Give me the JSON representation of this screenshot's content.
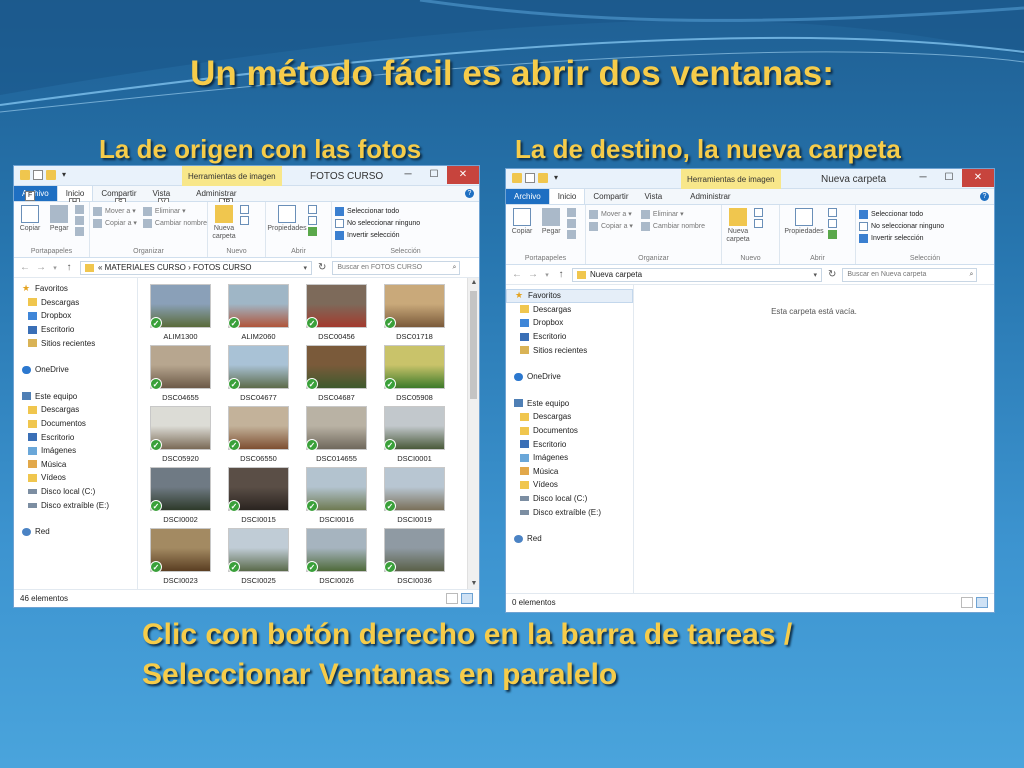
{
  "slide": {
    "title": "Un método fácil es abrir dos ventanas:",
    "subtitle_left": "La de origen con las fotos",
    "subtitle_right": "La de destino, la nueva carpeta",
    "bottom_line1": "Clic con botón derecho en la barra de tareas /",
    "bottom_line2": "Seleccionar Ventanas en paralelo"
  },
  "ribbon_common": {
    "tabs": [
      "Archivo",
      "Inicio",
      "Compartir",
      "Vista",
      "Administrar"
    ],
    "contextual_tab": "Herramientas de imagen",
    "copiar": "Copiar",
    "pegar": "Pegar",
    "mover_a": "Mover a ▾",
    "copiar_a": "Copiar a ▾",
    "eliminar": "Eliminar ▾",
    "cambiar_nombre": "Cambiar nombre",
    "nueva_carpeta_1": "Nueva",
    "nueva_carpeta_2": "carpeta",
    "propiedades": "Propiedades",
    "seleccionar_todo": "Seleccionar todo",
    "no_seleccionar": "No seleccionar ninguno",
    "invertir": "Invertir selección",
    "grp_portapapeles": "Portapapeles",
    "grp_organizar": "Organizar",
    "grp_nuevo": "Nuevo",
    "grp_abrir": "Abrir",
    "grp_seleccion": "Selección"
  },
  "window_left": {
    "title": "FOTOS CURSO",
    "keytips": [
      "H",
      "S",
      "V",
      "JP",
      "F",
      "1",
      "2",
      "E"
    ],
    "breadcrumb": "«  MATERIALES CURSO  ›  FOTOS CURSO",
    "search_placeholder": "Buscar en FOTOS CURSO",
    "status": "46 elementos",
    "photos": [
      {
        "name": "ALIM1300",
        "c1": "#8aa0b8",
        "c2": "#5a6b3a"
      },
      {
        "name": "ALIM2060",
        "c1": "#9fb6c6",
        "c2": "#b0553a"
      },
      {
        "name": "DSC00456",
        "c1": "#7d6a5a",
        "c2": "#a33a2e"
      },
      {
        "name": "DSC01718",
        "c1": "#c9a97a",
        "c2": "#7a5a3a"
      },
      {
        "name": "DSC04655",
        "c1": "#b7a68f",
        "c2": "#6c5a48"
      },
      {
        "name": "DSC04677",
        "c1": "#a9c2d6",
        "c2": "#5d6b4a"
      },
      {
        "name": "DSC04687",
        "c1": "#7a5a3a",
        "c2": "#3e5a2e"
      },
      {
        "name": "DSC05908",
        "c1": "#c9c36a",
        "c2": "#3d7a2a"
      },
      {
        "name": "DSC05920",
        "c1": "#dcdcd6",
        "c2": "#7a6a56"
      },
      {
        "name": "DSC06550",
        "c1": "#c3b29a",
        "c2": "#7d4f32"
      },
      {
        "name": "DSC014655",
        "c1": "#b9b2a4",
        "c2": "#6f685c"
      },
      {
        "name": "DSCI0001",
        "c1": "#c2c8cc",
        "c2": "#4a5a3a"
      },
      {
        "name": "DSCI0002",
        "c1": "#6f7a84",
        "c2": "#2e3a2a"
      },
      {
        "name": "DSCI0015",
        "c1": "#5a4e46",
        "c2": "#2a2420"
      },
      {
        "name": "DSCI0016",
        "c1": "#b3c3cf",
        "c2": "#6e7a52"
      },
      {
        "name": "DSCI0019",
        "c1": "#b8c6d2",
        "c2": "#7a705a"
      },
      {
        "name": "DSCI0023",
        "c1": "#a38a62",
        "c2": "#5a3e22"
      },
      {
        "name": "DSCI0025",
        "c1": "#c0ccd6",
        "c2": "#5a6a4a"
      },
      {
        "name": "DSCI0026",
        "c1": "#a6b4bf",
        "c2": "#4f6a3a"
      },
      {
        "name": "DSCI0036",
        "c1": "#8f9aa3",
        "c2": "#5a6048"
      }
    ]
  },
  "window_right": {
    "title": "Nueva carpeta",
    "breadcrumb": "Nueva carpeta",
    "search_placeholder": "Buscar en Nueva carpeta",
    "empty_message": "Esta carpeta está vacía.",
    "status": "0 elementos"
  },
  "nav_pane": {
    "favoritos": "Favoritos",
    "descargas": "Descargas",
    "dropbox": "Dropbox",
    "escritorio": "Escritorio",
    "sitios_recientes": "Sitios recientes",
    "onedrive": "OneDrive",
    "este_equipo": "Este equipo",
    "documentos": "Documentos",
    "imagenes": "Imágenes",
    "musica": "Música",
    "videos": "Vídeos",
    "disco_local": "Disco local (C:)",
    "disco_extraible": "Disco extraíble (E:)",
    "red": "Red"
  }
}
